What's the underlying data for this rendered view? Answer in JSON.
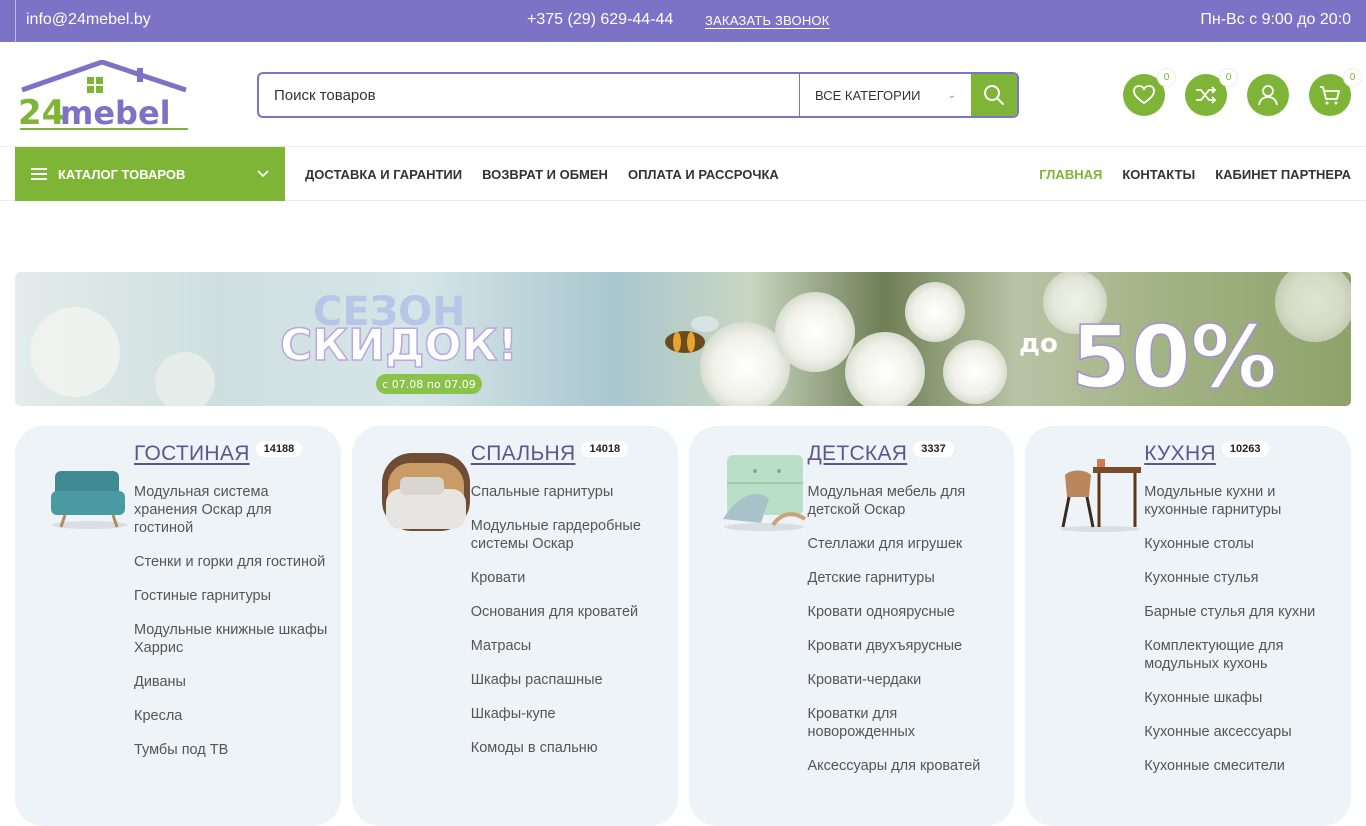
{
  "topbar": {
    "email": "info@24mebel.by",
    "phone": "+375 (29) 629-44-44",
    "callback": "ЗАКАЗАТЬ ЗВОНОК",
    "hours": "Пн-Вс с 9:00 до 20:0"
  },
  "logo": {
    "text": "24mebel"
  },
  "search": {
    "placeholder": "Поиск товаров",
    "category": "ВСЕ КАТЕГОРИИ"
  },
  "header_icons": {
    "wishlist_count": "0",
    "compare_count": "0",
    "cart_count": "0"
  },
  "nav": {
    "catalog": "КАТАЛОГ ТОВАРОВ",
    "left": [
      "ДОСТАВКА И ГАРАНТИИ",
      "ВОЗВРАТ И ОБМЕН",
      "ОПЛАТА И РАССРОЧКА"
    ],
    "right": [
      "ГЛАВНАЯ",
      "КОНТАКТЫ",
      "КАБИНЕТ ПАРТНЕРА"
    ]
  },
  "banner": {
    "line1": "СЕЗОН",
    "line2": "СКИДОК!",
    "dates": "с 07.08 по 07.09",
    "prefix": "до",
    "discount": "50%"
  },
  "categories": [
    {
      "title": "ГОСТИНАЯ",
      "count": "14188",
      "items": [
        "Модульная система хранения Оскар для гостиной",
        "Стенки и горки для гостиной",
        "Гостиные гарнитуры",
        "Модульные книжные шкафы Харрис",
        "Диваны",
        "Кресла",
        "Тумбы под ТВ"
      ]
    },
    {
      "title": "СПАЛЬНЯ",
      "count": "14018",
      "items": [
        "Спальные гарнитуры",
        "Модульные гардеробные системы Оскар",
        "Кровати",
        "Основания для кроватей",
        "Матрасы",
        "Шкафы распашные",
        "Шкафы-купе",
        "Комоды в спальню"
      ]
    },
    {
      "title": "ДЕТСКАЯ",
      "count": "3337",
      "items": [
        "Модульная мебель для детской Оскар",
        "Стеллажи для игрушек",
        "Детские гарнитуры",
        "Кровати одноярусные",
        "Кровати двухъярусные",
        "Кровати-чердаки",
        "Кроватки для новорожденных",
        "Аксессуары для кроватей"
      ]
    },
    {
      "title": "КУХНЯ",
      "count": "10263",
      "items": [
        "Модульные кухни и кухонные гарнитуры",
        "Кухонные столы",
        "Кухонные стулья",
        "Барные стулья для кухни",
        "Комплектующие для модульных кухонь",
        "Кухонные шкафы",
        "Кухонные аксессуары",
        "Кухонные смесители"
      ]
    }
  ],
  "colors": {
    "purple": "#7c72c6",
    "green": "#7fb537",
    "card_bg": "#eef3f7",
    "title": "#5d558f"
  }
}
